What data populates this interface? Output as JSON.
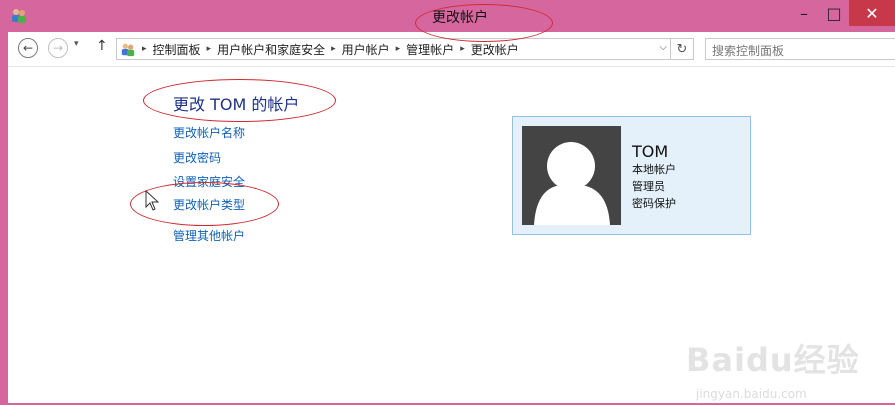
{
  "window": {
    "title": "更改帐户",
    "controls": {
      "minimize": "–",
      "maximize": "□",
      "close": "✕"
    }
  },
  "nav": {
    "back": "←",
    "forward": "→",
    "recent": "▾",
    "up": "↑"
  },
  "address": {
    "icon": "users-icon",
    "crumbs": [
      "控制面板",
      "用户帐户和家庭安全",
      "用户帐户",
      "管理帐户",
      "更改帐户"
    ],
    "separator": "▸",
    "dropdown": "⌵",
    "refresh": "↻"
  },
  "search": {
    "placeholder": "搜索控制面板"
  },
  "main": {
    "title": "更改 TOM 的帐户",
    "links": [
      "更改帐户名称",
      "更改密码",
      "设置家庭安全",
      "更改帐户类型",
      "管理其他帐户"
    ]
  },
  "account": {
    "name": "TOM",
    "details": [
      "本地帐户",
      "管理员",
      "密码保护"
    ]
  },
  "watermark": {
    "brand": "Baidu经验",
    "url": "jingyan.baidu.com"
  },
  "colors": {
    "titlebar": "#d6679e",
    "link": "#0f62b7",
    "card_bg": "#e4f1fa",
    "annotation": "#d02a33"
  }
}
